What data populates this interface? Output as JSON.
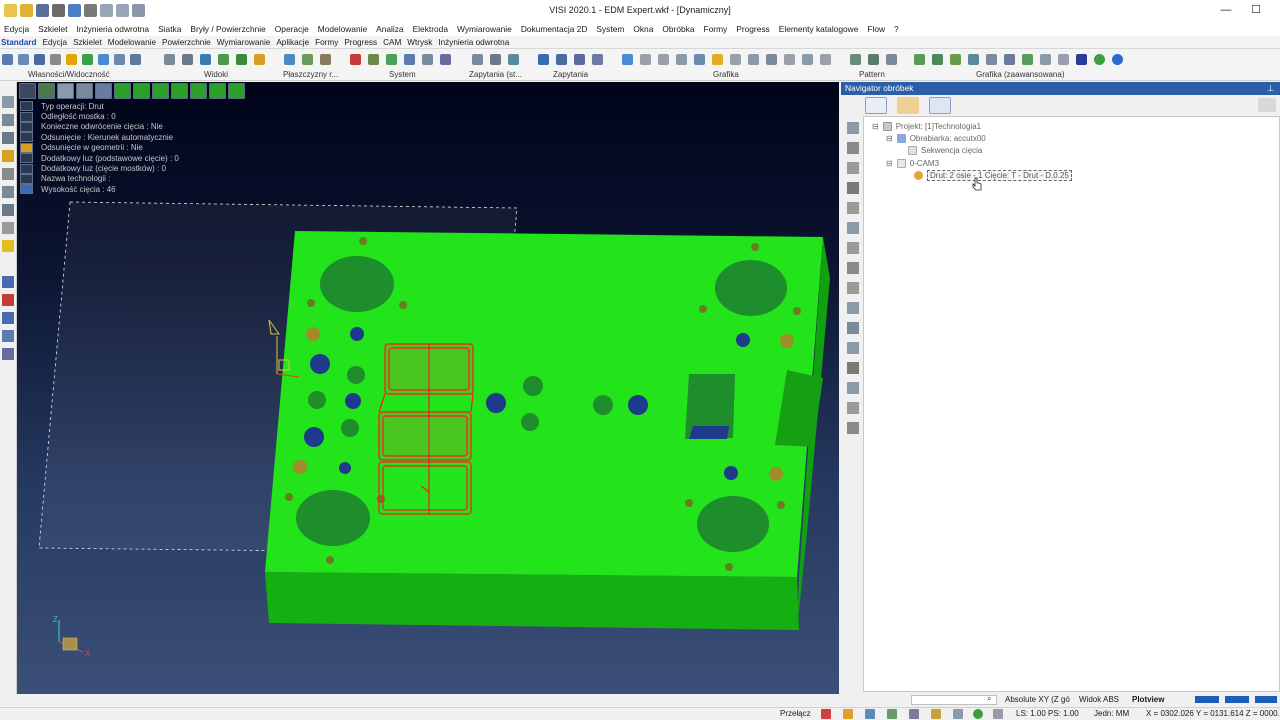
{
  "window": {
    "title": "VISI 2020.1 - EDM Expert.wkf - [Dynamiczny]",
    "minimize_label": "—",
    "maximize_label": "☐"
  },
  "menubar": {
    "items": [
      "Edycja",
      "Szkielet",
      "Inżynieria odwrotna",
      "Siatka",
      "Bryły / Powierzchnie",
      "Operacje",
      "Modelowanie",
      "Analiza",
      "Elektroda",
      "Wymiarowanie",
      "Dokumentacja 2D",
      "System",
      "Okna",
      "Obróbka",
      "Formy",
      "Progress",
      "Elementy katalogowe",
      "Flow",
      "?"
    ]
  },
  "ribbon_tabs": {
    "items": [
      "Standard",
      "Edycja",
      "Szkielet",
      "Modelowanie",
      "Powierzchnie",
      "Wymiarowanie",
      "Aplikacje",
      "Formy",
      "Progress",
      "CAM",
      "Wtrysk",
      "Inżynieria odwrotna"
    ],
    "active": "Standard"
  },
  "ribbon_groups": {
    "labels": [
      "Własności/Widoczność",
      "Widoki",
      "Płaszczyzny r...",
      "System",
      "Zapytania (st...",
      "Zapytania",
      "Grafika",
      "Pattern",
      "Grafika (zaawansowana)"
    ]
  },
  "operation_props": {
    "rows": [
      "Typ operacji: Drut",
      "Odległość mostka : 0",
      "Konieczne odwrócenie cięcia : Nie",
      "Odsunięcie : Kierunek automatycznie",
      "Odsunięcie w geometrii : Nie",
      "Dodatkowy luz (podstawowe cięcie) : 0",
      "Dodatkowy luz (cięcie mostków) : 0",
      "Nazwa technologii :",
      "Wysokość cięcia : 46"
    ]
  },
  "viewport": {
    "axis_z": "Z",
    "axis_x": "X",
    "part_color": "#22e01a",
    "part_side_color": "#17b512",
    "wire_color": "#ff1a1a"
  },
  "navigator": {
    "title": "Navigator obróbek",
    "pin_label": "⊥",
    "tree": [
      {
        "label": "Projekt: [1]Technologia1"
      },
      {
        "label": "Obrabiarka: accutx00"
      },
      {
        "label": "Sekwencja cięcia"
      },
      {
        "label": "0-CAM3"
      },
      {
        "label": "Drut: 2 osie - 1 Cięcie: T - Drut - D.0.25"
      }
    ]
  },
  "status": {
    "search_value": "",
    "coord_mode": "Absolute XY (Z gó",
    "view_mode": "Widok ABS",
    "plotview": "Plotview",
    "switch_label": "Przełącz",
    "ls_ps": "LS: 1.00 PS: 1.00",
    "units": "Jedn: MM",
    "coords": "X = 0302.026 Y = 0131.614 Z = 0000.0"
  }
}
